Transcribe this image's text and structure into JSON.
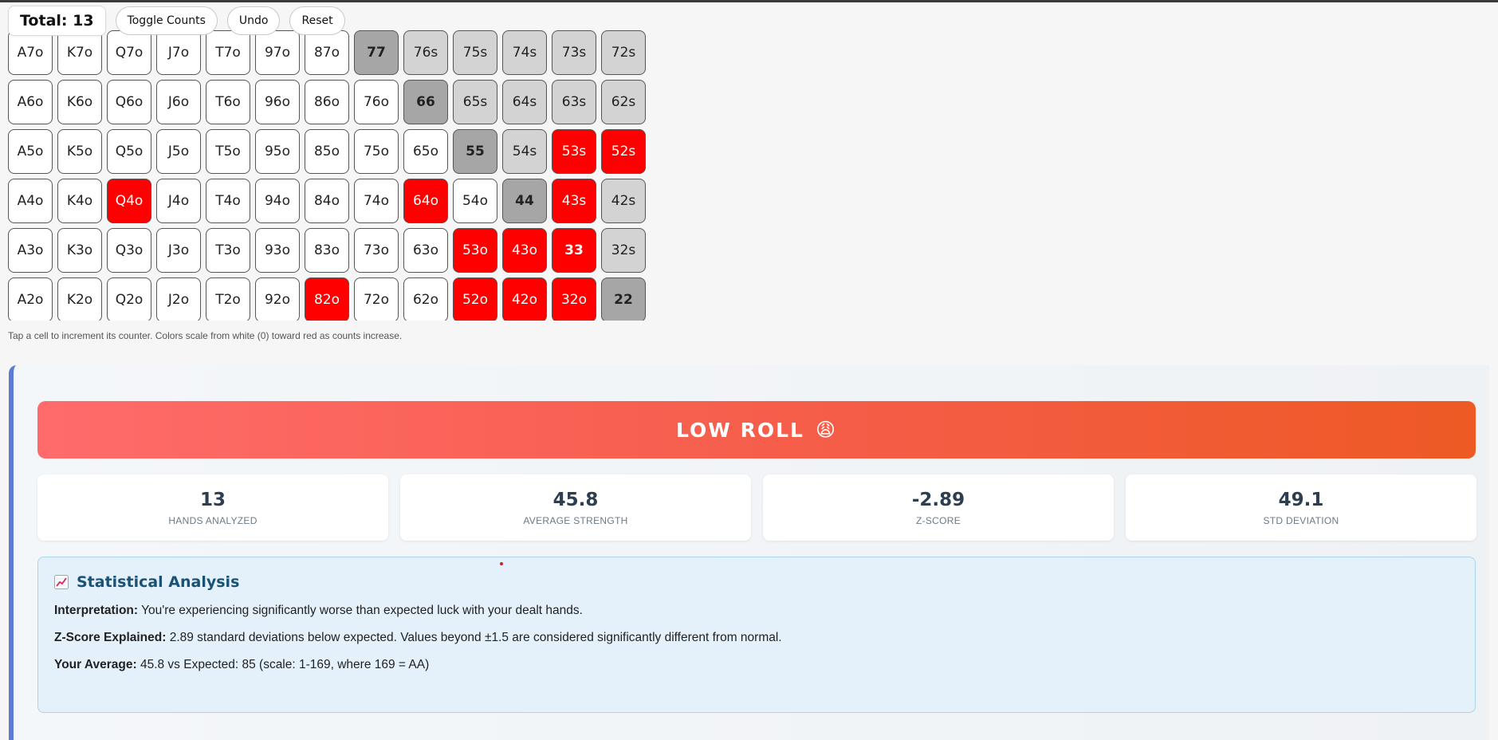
{
  "toolbar": {
    "total_label": "Total: 13",
    "toggle_label": "Toggle Counts",
    "undo_label": "Undo",
    "reset_label": "Reset"
  },
  "colors": {
    "hot": "#ff0000",
    "pair": "#a6a6a6",
    "light": "#d3d3d3",
    "cold": "#ffffff"
  },
  "grid": {
    "rows": [
      [
        [
          "A7o",
          "w"
        ],
        [
          "K7o",
          "w"
        ],
        [
          "Q7o",
          "w"
        ],
        [
          "J7o",
          "w"
        ],
        [
          "T7o",
          "w"
        ],
        [
          "97o",
          "w"
        ],
        [
          "87o",
          "w"
        ],
        [
          "77",
          "p"
        ],
        [
          "76s",
          "l"
        ],
        [
          "75s",
          "l"
        ],
        [
          "74s",
          "l"
        ],
        [
          "73s",
          "l"
        ],
        [
          "72s",
          "l"
        ]
      ],
      [
        [
          "A6o",
          "w"
        ],
        [
          "K6o",
          "w"
        ],
        [
          "Q6o",
          "w"
        ],
        [
          "J6o",
          "w"
        ],
        [
          "T6o",
          "w"
        ],
        [
          "96o",
          "w"
        ],
        [
          "86o",
          "w"
        ],
        [
          "76o",
          "w"
        ],
        [
          "66",
          "p"
        ],
        [
          "65s",
          "l"
        ],
        [
          "64s",
          "l"
        ],
        [
          "63s",
          "l"
        ],
        [
          "62s",
          "l"
        ]
      ],
      [
        [
          "A5o",
          "w"
        ],
        [
          "K5o",
          "w"
        ],
        [
          "Q5o",
          "w"
        ],
        [
          "J5o",
          "w"
        ],
        [
          "T5o",
          "w"
        ],
        [
          "95o",
          "w"
        ],
        [
          "85o",
          "w"
        ],
        [
          "75o",
          "w"
        ],
        [
          "65o",
          "w"
        ],
        [
          "55",
          "p"
        ],
        [
          "54s",
          "l"
        ],
        [
          "53s",
          "r"
        ],
        [
          "52s",
          "r"
        ]
      ],
      [
        [
          "A4o",
          "w"
        ],
        [
          "K4o",
          "w"
        ],
        [
          "Q4o",
          "r"
        ],
        [
          "J4o",
          "w"
        ],
        [
          "T4o",
          "w"
        ],
        [
          "94o",
          "w"
        ],
        [
          "84o",
          "w"
        ],
        [
          "74o",
          "w"
        ],
        [
          "64o",
          "r"
        ],
        [
          "54o",
          "w"
        ],
        [
          "44",
          "p"
        ],
        [
          "43s",
          "r"
        ],
        [
          "42s",
          "l"
        ]
      ],
      [
        [
          "A3o",
          "w"
        ],
        [
          "K3o",
          "w"
        ],
        [
          "Q3o",
          "w"
        ],
        [
          "J3o",
          "w"
        ],
        [
          "T3o",
          "w"
        ],
        [
          "93o",
          "w"
        ],
        [
          "83o",
          "w"
        ],
        [
          "73o",
          "w"
        ],
        [
          "63o",
          "w"
        ],
        [
          "53o",
          "r"
        ],
        [
          "43o",
          "r"
        ],
        [
          "33",
          "rp"
        ],
        [
          "32s",
          "l"
        ]
      ],
      [
        [
          "A2o",
          "w"
        ],
        [
          "K2o",
          "w"
        ],
        [
          "Q2o",
          "w"
        ],
        [
          "J2o",
          "w"
        ],
        [
          "T2o",
          "w"
        ],
        [
          "92o",
          "w"
        ],
        [
          "82o",
          "r"
        ],
        [
          "72o",
          "w"
        ],
        [
          "62o",
          "w"
        ],
        [
          "52o",
          "r"
        ],
        [
          "42o",
          "r"
        ],
        [
          "32o",
          "r"
        ],
        [
          "22",
          "p"
        ]
      ]
    ]
  },
  "hint": "Tap a cell to increment its counter. Colors scale from white (0) toward red as counts increase.",
  "result": {
    "banner": "LOW ROLL",
    "banner_emoji": "😩",
    "stats": [
      {
        "value": "13",
        "label": "HANDS ANALYZED"
      },
      {
        "value": "45.8",
        "label": "AVERAGE STRENGTH"
      },
      {
        "value": "-2.89",
        "label": "Z-SCORE"
      },
      {
        "value": "49.1",
        "label": "STD DEVIATION"
      }
    ],
    "analysis": {
      "icon": "chart-increasing-icon",
      "title": "Statistical Analysis",
      "lines": [
        {
          "label": "Interpretation:",
          "text": " You're experiencing significantly worse than expected luck with your dealt hands."
        },
        {
          "label": "Z-Score Explained:",
          "text": " 2.89 standard deviations below expected. Values beyond ±1.5 are considered significantly different from normal."
        },
        {
          "label": "Your Average:",
          "text": " 45.8 vs Expected: 85 (scale: 1-169, where 169 = AA)"
        }
      ]
    }
  }
}
